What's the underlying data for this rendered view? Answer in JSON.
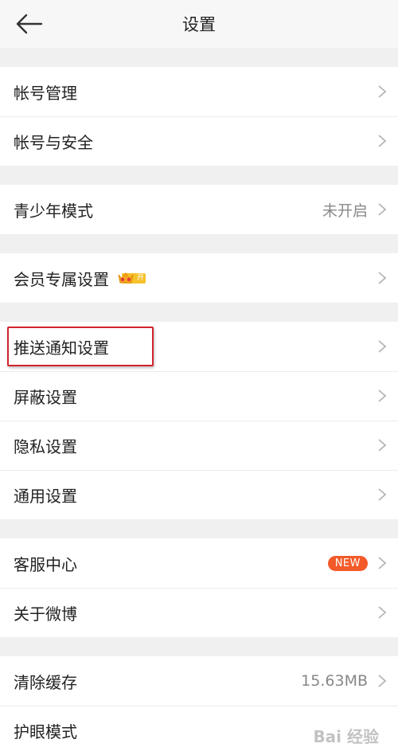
{
  "header": {
    "title": "设置",
    "back_icon": "arrow-left-icon"
  },
  "groups": [
    {
      "items": [
        {
          "label": "帐号管理"
        },
        {
          "label": "帐号与安全"
        }
      ]
    },
    {
      "items": [
        {
          "label": "青少年模式",
          "value": "未开启"
        }
      ]
    },
    {
      "items": [
        {
          "label": "会员专属设置",
          "vip_badge": "开"
        }
      ]
    },
    {
      "items": [
        {
          "label": "推送通知设置",
          "highlighted": true
        },
        {
          "label": "屏蔽设置"
        },
        {
          "label": "隐私设置"
        },
        {
          "label": "通用设置"
        }
      ]
    },
    {
      "items": [
        {
          "label": "客服中心",
          "badge": "NEW"
        },
        {
          "label": "关于微博"
        }
      ]
    },
    {
      "items": [
        {
          "label": "清除缓存",
          "value": "15.63MB"
        },
        {
          "label": "护眼模式"
        }
      ]
    }
  ],
  "watermark": "Bai 经验",
  "colors": {
    "accent": "#f25a29",
    "highlight": "#d2242d",
    "vip": "#f5c22c"
  }
}
